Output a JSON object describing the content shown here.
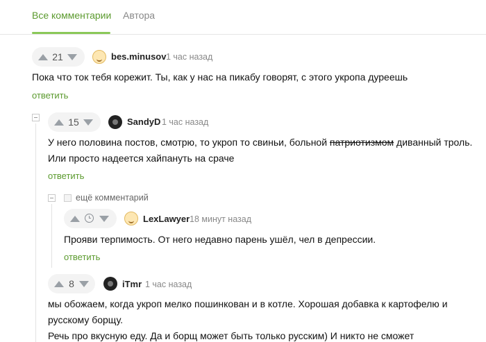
{
  "tabs": {
    "all": "Все комментарии",
    "author": "Автора"
  },
  "comments": [
    {
      "score": "21",
      "user": "bes.minusov",
      "time": "1 час назад",
      "text": "Пока что ток тебя корежит. Ты, как у нас на пикабу говорят, с этого укропа дуреешь",
      "reply": "ответить"
    },
    {
      "score": "15",
      "user": "SandyD",
      "time": "1 час назад",
      "text_line1_a": "У него половина постов, смотрю, то укроп то свиньи, больной ",
      "text_line1_strike": "патриотизмом",
      "text_line1_b": " диванный троль.",
      "text_line2": "Или просто надеется хайпануть на сраче",
      "reply": "ответить"
    },
    {
      "more": "ещё комментарий",
      "score_icon": "clock-icon",
      "user": "LexLawyer",
      "time": "18 минут назад",
      "text": "Прояви терпимость. От него недавно парень ушёл, чел в депрессии.",
      "reply": "ответить"
    },
    {
      "score": "8",
      "user": "iTmr",
      "time": "1 час назад",
      "text_line1": "мы обожаем, когда укроп мелко пошинкован и в котле. Хорошая добавка к картофелю и",
      "text_line2": "русскому борщу.",
      "text_line3": "Речь про вкусную еду. Да и борщ может быть только русским) И никто не сможет"
    }
  ],
  "colors": {
    "accent": "#5b9a2e",
    "tab_underline": "#8ac858",
    "muted": "#888888"
  }
}
